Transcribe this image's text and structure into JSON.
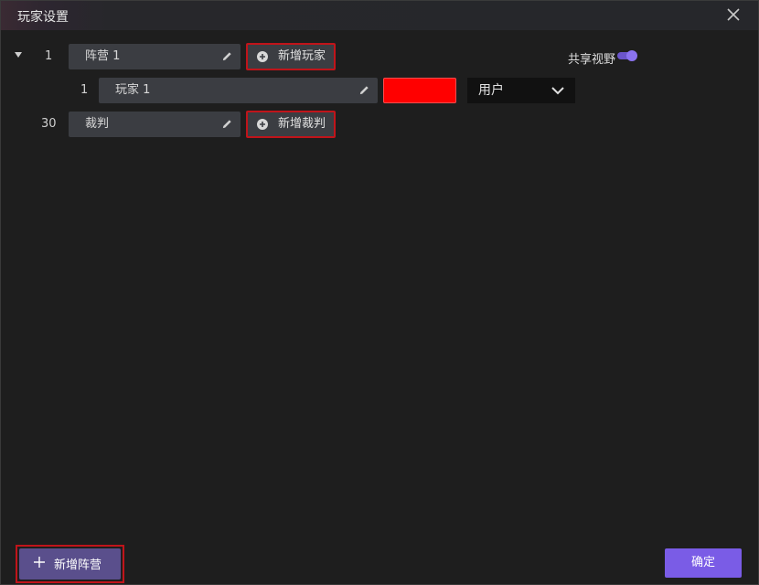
{
  "window": {
    "title": "玩家设置"
  },
  "camp": {
    "index": "1",
    "name": "阵营 1",
    "add_player_label": "新增玩家",
    "share_vision_label": "共享视野",
    "share_vision_on": true
  },
  "player": {
    "index": "1",
    "name": "玩家 1",
    "color": "#ff0000",
    "role_selected": "用户"
  },
  "referee": {
    "index": "30",
    "name": "裁判",
    "add_referee_label": "新增裁判"
  },
  "footer": {
    "add_camp_label": "新增阵营",
    "confirm_label": "确定"
  },
  "icons": [
    "close-icon",
    "caret-down-icon",
    "pencil-icon",
    "plus-circle-icon",
    "chevron-down-icon",
    "plus-icon"
  ],
  "colors": {
    "accent": "#7a5ce6",
    "highlight_border": "#c0141a"
  }
}
